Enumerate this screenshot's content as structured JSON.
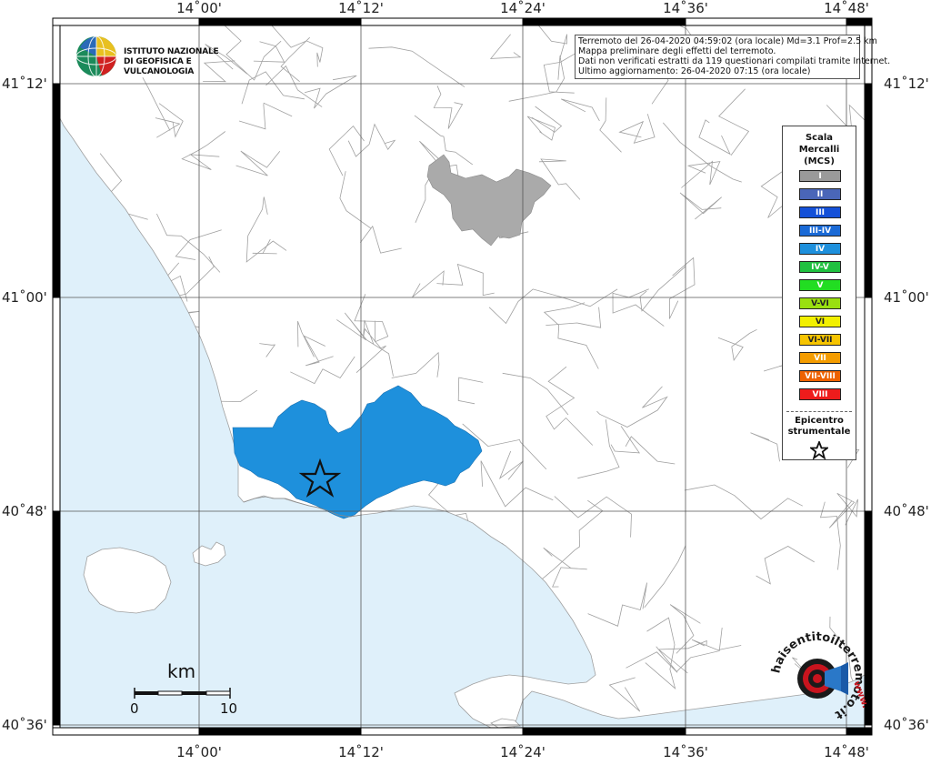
{
  "map": {
    "lon_labels": [
      "14˚00'",
      "14˚12'",
      "14˚24'",
      "14˚36'",
      "14˚48'"
    ],
    "lat_labels": [
      "41˚12'",
      "41˚00'",
      "40˚48'",
      "40˚36'"
    ],
    "colors": {
      "sea": "#dff0fa",
      "land": "#ffffff",
      "border": "#a0a0a0",
      "grid": "#555555",
      "frame": "#000000",
      "affected_area": "#1e90dc",
      "intensity_I_area": "#aaaaaa"
    }
  },
  "info": {
    "line1": "Terremoto del 26-04-2020 04:59:02 (ora locale) Md=3.1 Prof=2.5 km",
    "line2": "Mappa preliminare degli effetti del terremoto.",
    "line3": "Dati non verificati estratti da 119 questionari compilati tramite Internet.",
    "line4": "Ultimo aggiornamento: 26-04-2020 07:15 (ora locale)"
  },
  "logo": {
    "line1": "ISTITUTO NAZIONALE",
    "line2": "DI GEOFISICA E VULCANOLOGIA"
  },
  "legend": {
    "title": "Scala\nMercalli\n(MCS)",
    "items": [
      {
        "label": "I",
        "color": "#9a9a9a"
      },
      {
        "label": "II",
        "color": "#4a66b8"
      },
      {
        "label": "III",
        "color": "#1450d8"
      },
      {
        "label": "III-IV",
        "color": "#1a6ad6"
      },
      {
        "label": "IV",
        "color": "#1e90dc"
      },
      {
        "label": "IV-V",
        "color": "#20c040"
      },
      {
        "label": "V",
        "color": "#22dd22"
      },
      {
        "label": "V-VI",
        "color": "#9ae010"
      },
      {
        "label": "VI",
        "color": "#f2f000"
      },
      {
        "label": "VI-VII",
        "color": "#f6c400"
      },
      {
        "label": "VII",
        "color": "#f49c00"
      },
      {
        "label": "VII-VIII",
        "color": "#ee6200"
      },
      {
        "label": "VIII",
        "color": "#ee1c1c"
      }
    ],
    "epicentre_label": "Epicentro\nstrumentale"
  },
  "scale": {
    "unit": "km",
    "start": "0",
    "end": "10"
  },
  "hst_logo": {
    "text": "haisentitoilterremoto.it",
    "www": "www."
  }
}
